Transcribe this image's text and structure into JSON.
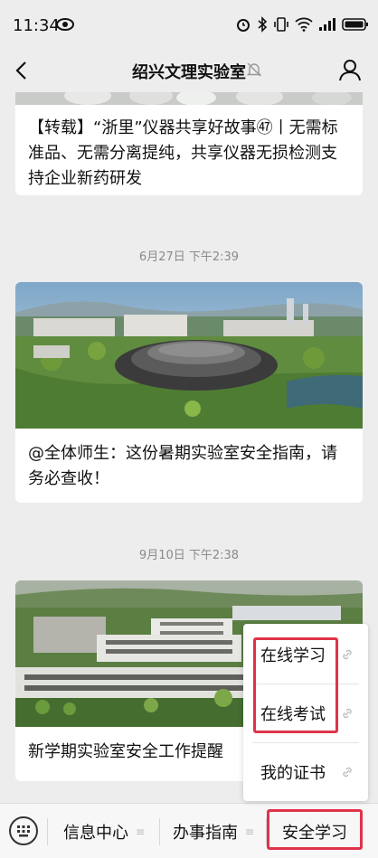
{
  "status_bar": {
    "time": "11:34"
  },
  "nav": {
    "title": "绍兴文理实验室"
  },
  "articles": [
    {
      "title": "【转载】“浙里”仪器共享好故事㊼丨无需标准品、无需分离提纯，共享仪器无损检测支持企业新药研发"
    },
    {
      "timestamp": "6月27日 下午2:39",
      "title": "@全体师生：这份暑期实验室安全指南，请务必查收！"
    },
    {
      "timestamp": "9月10日 下午2:38",
      "title": "新学期实验室安全工作提醒"
    }
  ],
  "menu": {
    "items": [
      "信息中心",
      "办事指南",
      "安全学习"
    ],
    "submenu": [
      "在线学习",
      "在线考试",
      "我的证书"
    ]
  },
  "colors": {
    "highlight": "#e0334a",
    "background": "#ededed"
  }
}
